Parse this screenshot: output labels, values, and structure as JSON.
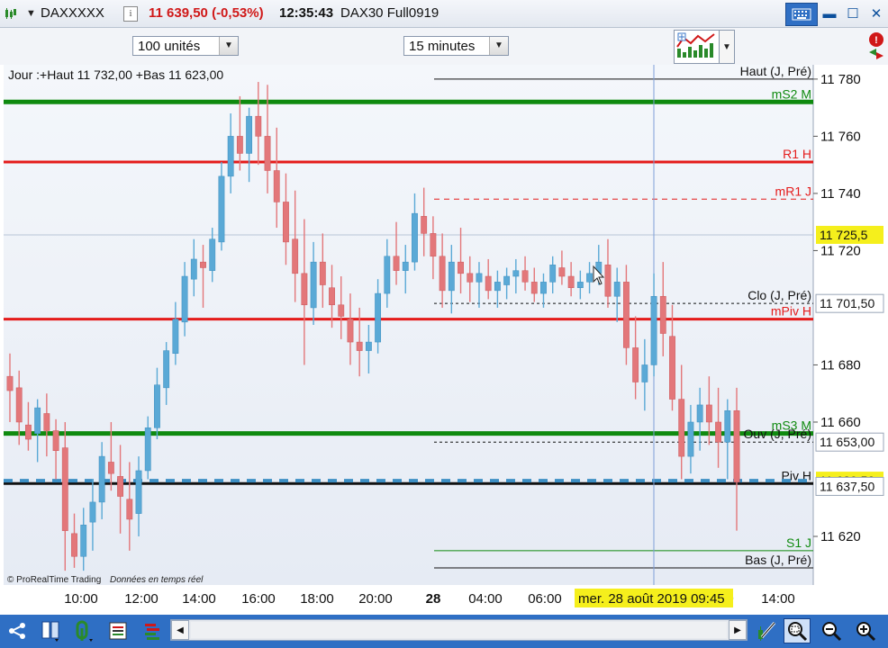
{
  "titlebar": {
    "symbol": "DAXXXXX",
    "price_change": "11 639,50 (-0,53%)",
    "time": "12:35:43",
    "instrument": "DAX30 Full0919",
    "info_label": "i"
  },
  "toolbar": {
    "units_select": "100 unités",
    "timeframe_select": "15 minutes"
  },
  "chart": {
    "header": "Jour :+Haut 11 732,00 +Bas 11 623,00",
    "watermark_brand": "© ProRealTime Trading",
    "watermark_realtime": "Données en temps réel",
    "crosshair_date": "mer. 28 août 2019 09:45",
    "colors": {
      "bull_candle": "#5aa9d6",
      "bear_candle": "#e3777a",
      "resistance_line": "#e41b1b",
      "support_line": "#0f8a0f",
      "pivot_line": "#111111",
      "price_badge": "#f5ef1c",
      "chart_bg_top": "#f4f7fb",
      "chart_bg_bottom": "#e6ebf4"
    }
  },
  "chart_data": {
    "type": "candlestick",
    "y_ticks": [
      "11 780",
      "11 760",
      "11 740",
      "11 720",
      "11 680",
      "11 660",
      "11 620"
    ],
    "x_ticks": [
      "10:00",
      "12:00",
      "14:00",
      "16:00",
      "18:00",
      "20:00",
      "28",
      "04:00",
      "06:00",
      "10:00",
      "14:00"
    ],
    "ylim": [
      11603,
      11785
    ],
    "price_badges": [
      {
        "text": "11 725,5",
        "value": 11725.5,
        "style": "yellow"
      },
      {
        "text": "11 701,50",
        "value": 11701.5,
        "style": "plain"
      },
      {
        "text": "11 653,00",
        "value": 11653.0,
        "style": "plain"
      },
      {
        "text": "11 639,50",
        "value": 11639.5,
        "style": "yellow"
      },
      {
        "text": "11 637,50",
        "value": 11637.5,
        "style": "plain"
      }
    ],
    "levels": [
      {
        "label": "Haut (J, Pré)",
        "value": 11780,
        "color": "#111111",
        "style": "thin"
      },
      {
        "label": "mS2 M",
        "value": 11772,
        "color": "#0f8a0f",
        "style": "thick"
      },
      {
        "label": "R1 H",
        "value": 11751,
        "color": "#e41b1b",
        "style": "medium"
      },
      {
        "label": "mR1 J",
        "value": 11738,
        "color": "#e41b1b",
        "style": "dashed"
      },
      {
        "label": "Clo (J, Pré)",
        "value": 11701.5,
        "color": "#111111",
        "style": "dotted"
      },
      {
        "label": "mPiv H",
        "value": 11696,
        "color": "#e41b1b",
        "style": "medium"
      },
      {
        "label": "mS3 M",
        "value": 11656,
        "color": "#0f8a0f",
        "style": "thick"
      },
      {
        "label": "Ouv (J, Pré)",
        "value": 11653,
        "color": "#111111",
        "style": "dotted"
      },
      {
        "label": "Piv H",
        "value": 11638.5,
        "color": "#111111",
        "style": "medium"
      },
      {
        "label": "S1 J",
        "value": 11615,
        "color": "#0f8a0f",
        "style": "thin"
      },
      {
        "label": "Bas (J, Pré)",
        "value": 11609,
        "color": "#111111",
        "style": "thin"
      }
    ],
    "candles": [
      {
        "o": 11676,
        "h": 11684,
        "l": 11660,
        "c": 11671
      },
      {
        "o": 11672,
        "h": 11678,
        "l": 11652,
        "c": 11660
      },
      {
        "o": 11659,
        "h": 11667,
        "l": 11650,
        "c": 11654
      },
      {
        "o": 11656,
        "h": 11668,
        "l": 11646,
        "c": 11665
      },
      {
        "o": 11663,
        "h": 11670,
        "l": 11648,
        "c": 11657
      },
      {
        "o": 11657,
        "h": 11661,
        "l": 11640,
        "c": 11650
      },
      {
        "o": 11651,
        "h": 11660,
        "l": 11608,
        "c": 11622
      },
      {
        "o": 11621,
        "h": 11628,
        "l": 11609,
        "c": 11613
      },
      {
        "o": 11613,
        "h": 11630,
        "l": 11608,
        "c": 11624
      },
      {
        "o": 11625,
        "h": 11640,
        "l": 11615,
        "c": 11632
      },
      {
        "o": 11632,
        "h": 11653,
        "l": 11626,
        "c": 11648
      },
      {
        "o": 11646,
        "h": 11660,
        "l": 11636,
        "c": 11642
      },
      {
        "o": 11641,
        "h": 11652,
        "l": 11621,
        "c": 11634
      },
      {
        "o": 11633,
        "h": 11646,
        "l": 11615,
        "c": 11626
      },
      {
        "o": 11628,
        "h": 11648,
        "l": 11620,
        "c": 11643
      },
      {
        "o": 11643,
        "h": 11662,
        "l": 11640,
        "c": 11658
      },
      {
        "o": 11658,
        "h": 11679,
        "l": 11654,
        "c": 11673
      },
      {
        "o": 11672,
        "h": 11688,
        "l": 11666,
        "c": 11685
      },
      {
        "o": 11684,
        "h": 11702,
        "l": 11680,
        "c": 11696
      },
      {
        "o": 11695,
        "h": 11716,
        "l": 11690,
        "c": 11711
      },
      {
        "o": 11710,
        "h": 11724,
        "l": 11704,
        "c": 11717
      },
      {
        "o": 11716,
        "h": 11722,
        "l": 11700,
        "c": 11714
      },
      {
        "o": 11713,
        "h": 11728,
        "l": 11709,
        "c": 11724
      },
      {
        "o": 11723,
        "h": 11751,
        "l": 11720,
        "c": 11746
      },
      {
        "o": 11746,
        "h": 11768,
        "l": 11740,
        "c": 11760
      },
      {
        "o": 11760,
        "h": 11774,
        "l": 11748,
        "c": 11754
      },
      {
        "o": 11754,
        "h": 11770,
        "l": 11744,
        "c": 11767
      },
      {
        "o": 11767,
        "h": 11779,
        "l": 11750,
        "c": 11760
      },
      {
        "o": 11760,
        "h": 11778,
        "l": 11740,
        "c": 11748
      },
      {
        "o": 11748,
        "h": 11763,
        "l": 11728,
        "c": 11737
      },
      {
        "o": 11737,
        "h": 11747,
        "l": 11715,
        "c": 11723
      },
      {
        "o": 11724,
        "h": 11741,
        "l": 11702,
        "c": 11712
      },
      {
        "o": 11712,
        "h": 11731,
        "l": 11680,
        "c": 11701
      },
      {
        "o": 11700,
        "h": 11723,
        "l": 11694,
        "c": 11716
      },
      {
        "o": 11716,
        "h": 11726,
        "l": 11700,
        "c": 11708
      },
      {
        "o": 11707,
        "h": 11715,
        "l": 11693,
        "c": 11701
      },
      {
        "o": 11701,
        "h": 11711,
        "l": 11689,
        "c": 11697
      },
      {
        "o": 11696,
        "h": 11705,
        "l": 11680,
        "c": 11688
      },
      {
        "o": 11688,
        "h": 11700,
        "l": 11676,
        "c": 11685
      },
      {
        "o": 11685,
        "h": 11694,
        "l": 11677,
        "c": 11688
      },
      {
        "o": 11688,
        "h": 11710,
        "l": 11684,
        "c": 11705
      },
      {
        "o": 11705,
        "h": 11724,
        "l": 11700,
        "c": 11718
      },
      {
        "o": 11718,
        "h": 11730,
        "l": 11708,
        "c": 11713
      },
      {
        "o": 11713,
        "h": 11722,
        "l": 11705,
        "c": 11716
      },
      {
        "o": 11716,
        "h": 11740,
        "l": 11713,
        "c": 11733
      },
      {
        "o": 11732,
        "h": 11742,
        "l": 11718,
        "c": 11726
      },
      {
        "o": 11726,
        "h": 11732,
        "l": 11710,
        "c": 11718
      },
      {
        "o": 11718,
        "h": 11726,
        "l": 11700,
        "c": 11706
      },
      {
        "o": 11706,
        "h": 11722,
        "l": 11698,
        "c": 11716
      },
      {
        "o": 11716,
        "h": 11728,
        "l": 11705,
        "c": 11712
      },
      {
        "o": 11712,
        "h": 11718,
        "l": 11702,
        "c": 11709
      },
      {
        "o": 11709,
        "h": 11716,
        "l": 11700,
        "c": 11712
      },
      {
        "o": 11711,
        "h": 11717,
        "l": 11703,
        "c": 11706
      },
      {
        "o": 11706,
        "h": 11713,
        "l": 11700,
        "c": 11709
      },
      {
        "o": 11708,
        "h": 11714,
        "l": 11703,
        "c": 11711
      },
      {
        "o": 11711,
        "h": 11717,
        "l": 11705,
        "c": 11713
      },
      {
        "o": 11713,
        "h": 11718,
        "l": 11706,
        "c": 11709
      },
      {
        "o": 11709,
        "h": 11714,
        "l": 11702,
        "c": 11705
      },
      {
        "o": 11705,
        "h": 11712,
        "l": 11700,
        "c": 11709
      },
      {
        "o": 11709,
        "h": 11718,
        "l": 11705,
        "c": 11715
      },
      {
        "o": 11714,
        "h": 11720,
        "l": 11708,
        "c": 11711
      },
      {
        "o": 11711,
        "h": 11716,
        "l": 11704,
        "c": 11707
      },
      {
        "o": 11707,
        "h": 11713,
        "l": 11703,
        "c": 11709
      },
      {
        "o": 11709,
        "h": 11716,
        "l": 11705,
        "c": 11712
      },
      {
        "o": 11712,
        "h": 11722,
        "l": 11708,
        "c": 11716
      },
      {
        "o": 11715,
        "h": 11724,
        "l": 11700,
        "c": 11704
      },
      {
        "o": 11704,
        "h": 11714,
        "l": 11695,
        "c": 11709
      },
      {
        "o": 11709,
        "h": 11715,
        "l": 11680,
        "c": 11686
      },
      {
        "o": 11686,
        "h": 11697,
        "l": 11668,
        "c": 11674
      },
      {
        "o": 11674,
        "h": 11689,
        "l": 11664,
        "c": 11680
      },
      {
        "o": 11680,
        "h": 11712,
        "l": 11676,
        "c": 11704
      },
      {
        "o": 11704,
        "h": 11716,
        "l": 11683,
        "c": 11691
      },
      {
        "o": 11690,
        "h": 11701,
        "l": 11664,
        "c": 11668
      },
      {
        "o": 11668,
        "h": 11680,
        "l": 11640,
        "c": 11648
      },
      {
        "o": 11648,
        "h": 11666,
        "l": 11642,
        "c": 11660
      },
      {
        "o": 11660,
        "h": 11672,
        "l": 11650,
        "c": 11666
      },
      {
        "o": 11666,
        "h": 11676,
        "l": 11652,
        "c": 11660
      },
      {
        "o": 11660,
        "h": 11672,
        "l": 11644,
        "c": 11653
      },
      {
        "o": 11653,
        "h": 11668,
        "l": 11640,
        "c": 11664
      },
      {
        "o": 11664,
        "h": 11672,
        "l": 11622,
        "c": 11639
      }
    ]
  },
  "right_stack": {
    "alert_label": "!"
  }
}
